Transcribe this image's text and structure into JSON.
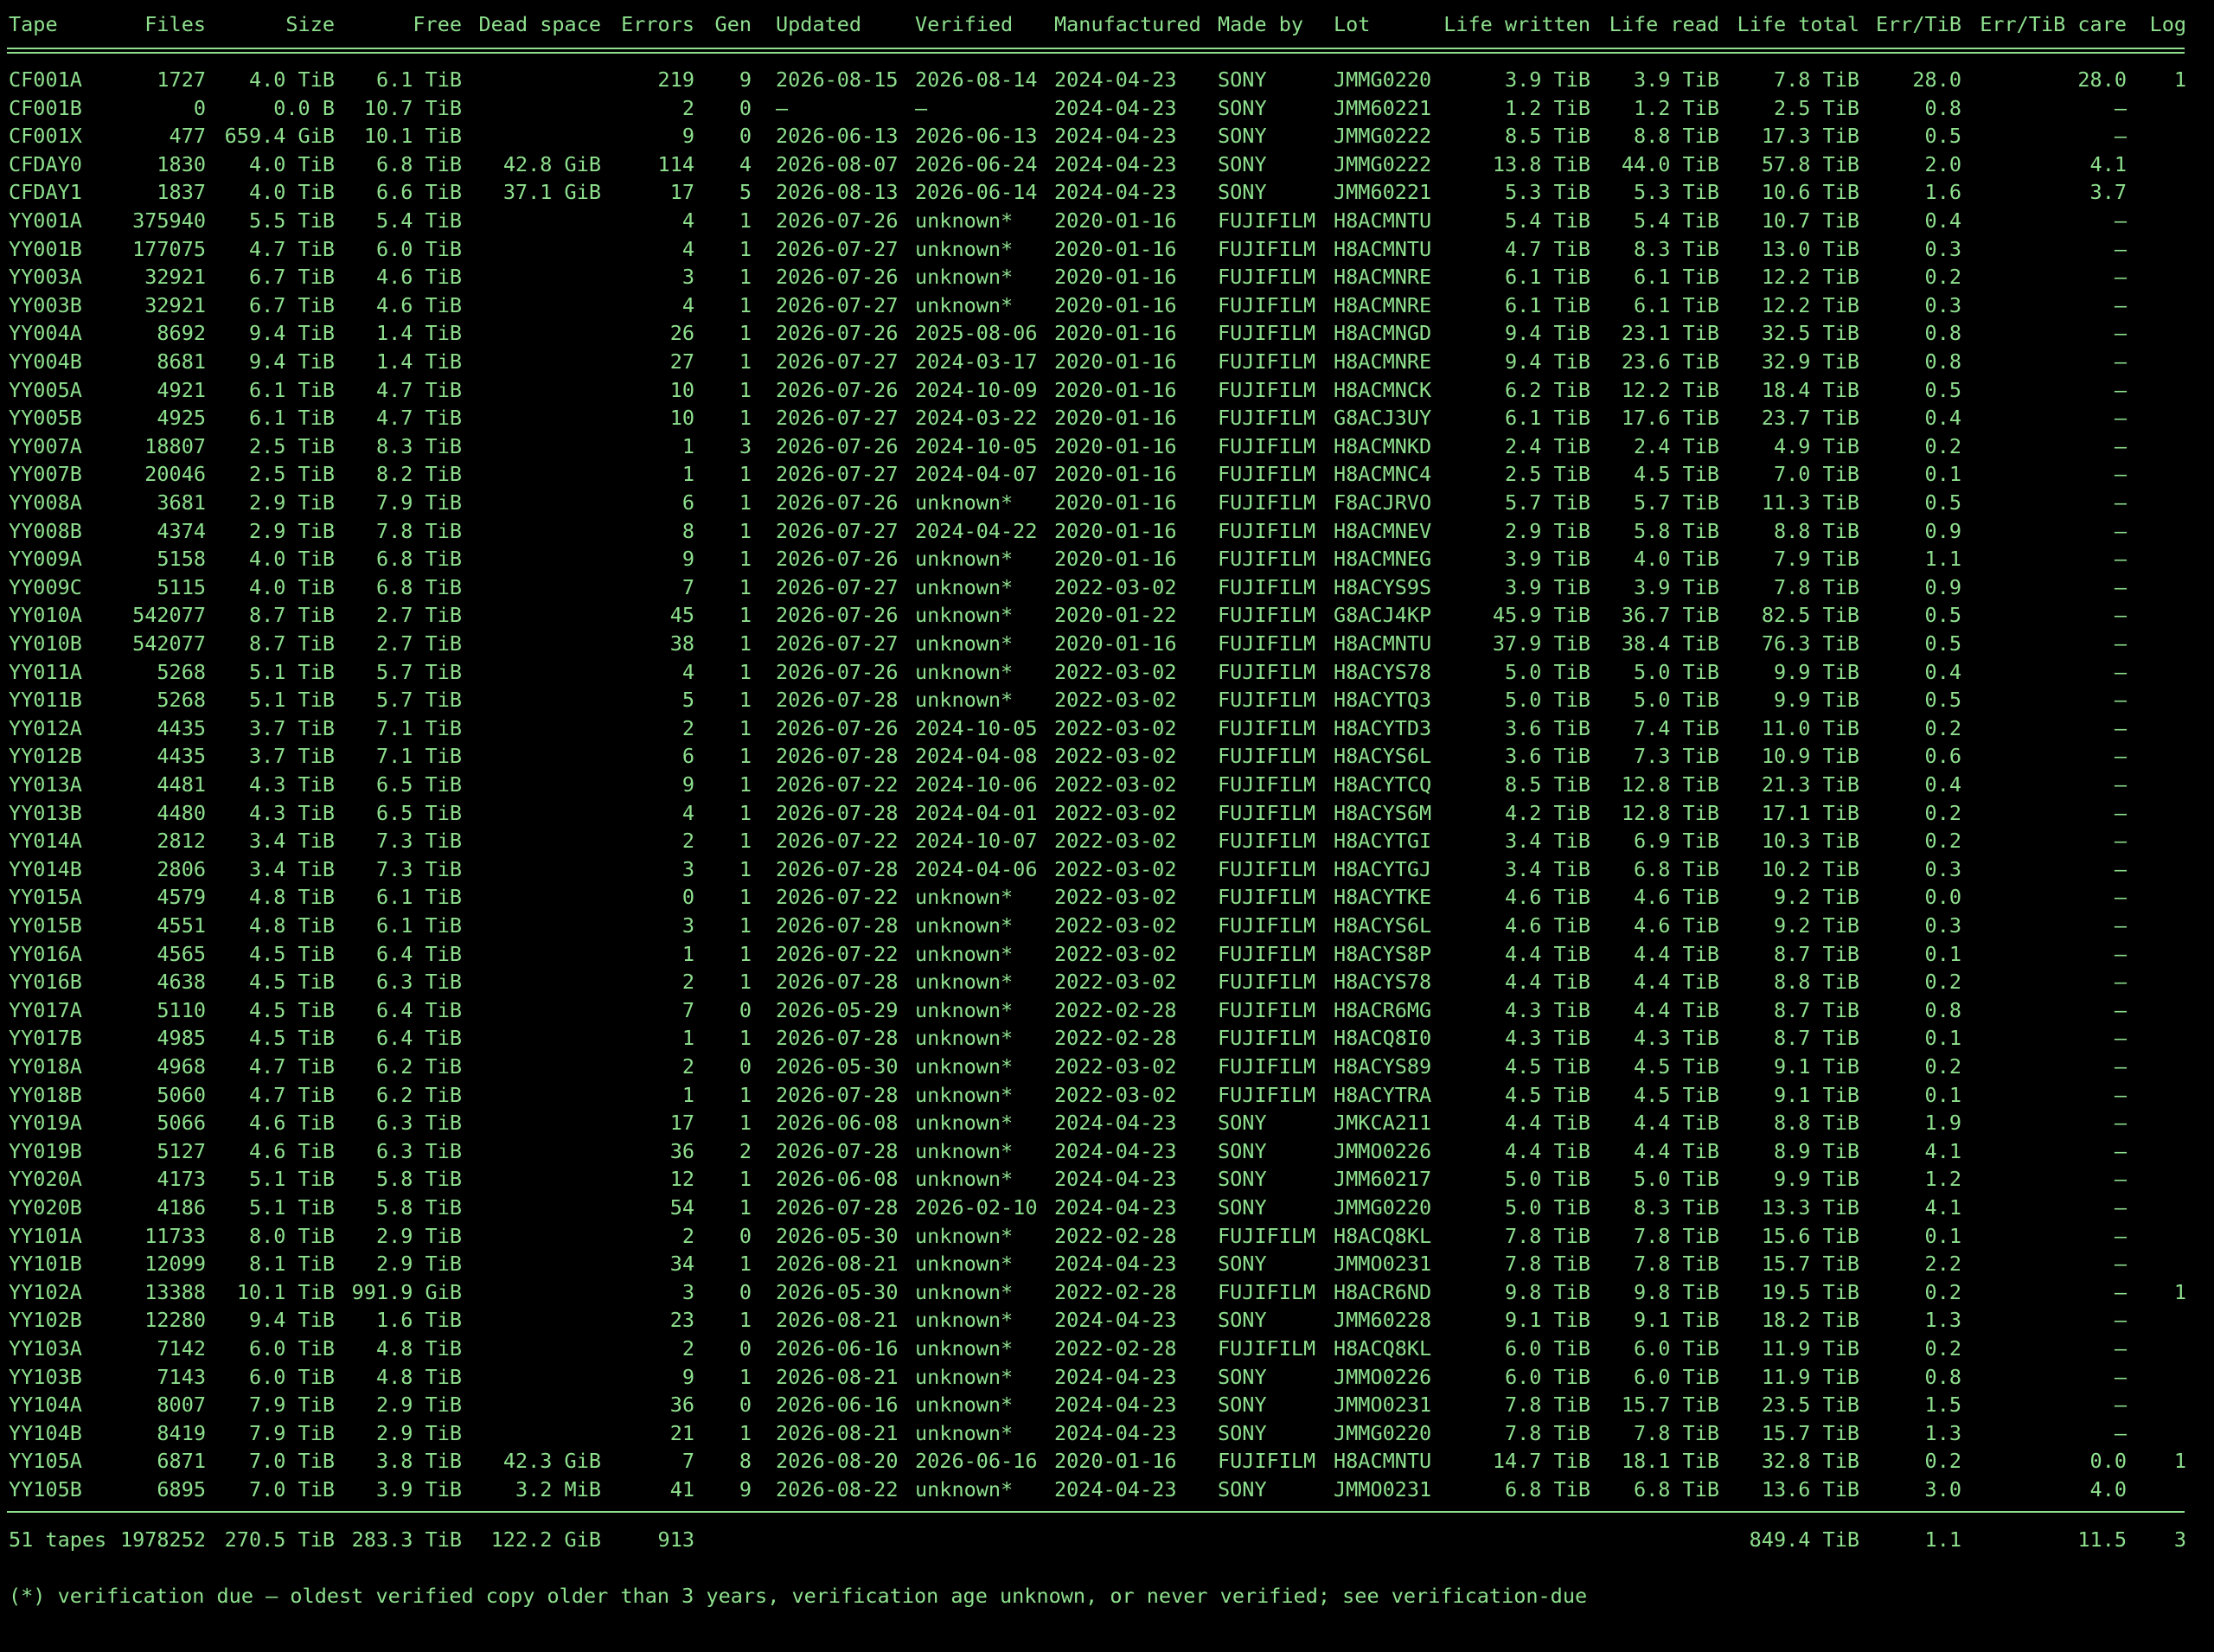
{
  "columns": [
    {
      "key": "tape",
      "label": "Tape"
    },
    {
      "key": "files",
      "label": "Files"
    },
    {
      "key": "size",
      "label": "Size"
    },
    {
      "key": "free",
      "label": "Free"
    },
    {
      "key": "dead",
      "label": "Dead space"
    },
    {
      "key": "errors",
      "label": "Errors"
    },
    {
      "key": "gen",
      "label": "Gen"
    },
    {
      "key": "updated",
      "label": "Updated"
    },
    {
      "key": "verified",
      "label": "Verified"
    },
    {
      "key": "manufactured",
      "label": "Manufactured"
    },
    {
      "key": "madeby",
      "label": "Made by"
    },
    {
      "key": "lot",
      "label": "Lot"
    },
    {
      "key": "lifewritten",
      "label": "Life written"
    },
    {
      "key": "liferead",
      "label": "Life read"
    },
    {
      "key": "lifetotal",
      "label": "Life total"
    },
    {
      "key": "errtib",
      "label": "Err/TiB"
    },
    {
      "key": "errtibcare",
      "label": "Err/TiB care"
    },
    {
      "key": "log",
      "label": "Log"
    }
  ],
  "rows": [
    [
      "CF001A",
      "1727",
      "4.0 TiB",
      "6.1 TiB",
      "",
      "219",
      "9",
      "2026-08-15",
      "2026-08-14",
      "2024-04-23",
      "SONY",
      "JMMG0220",
      "3.9 TiB",
      "3.9 TiB",
      "7.8 TiB",
      "28.0",
      "28.0",
      "1"
    ],
    [
      "CF001B",
      "0",
      "0.0 B",
      "10.7 TiB",
      "",
      "2",
      "0",
      "–",
      "–",
      "2024-04-23",
      "SONY",
      "JMM60221",
      "1.2 TiB",
      "1.2 TiB",
      "2.5 TiB",
      "0.8",
      "–",
      ""
    ],
    [
      "CF001X",
      "477",
      "659.4 GiB",
      "10.1 TiB",
      "",
      "9",
      "0",
      "2026-06-13",
      "2026-06-13",
      "2024-04-23",
      "SONY",
      "JMMG0222",
      "8.5 TiB",
      "8.8 TiB",
      "17.3 TiB",
      "0.5",
      "–",
      ""
    ],
    [
      "CFDAY0",
      "1830",
      "4.0 TiB",
      "6.8 TiB",
      "42.8 GiB",
      "114",
      "4",
      "2026-08-07",
      "2026-06-24",
      "2024-04-23",
      "SONY",
      "JMMG0222",
      "13.8 TiB",
      "44.0 TiB",
      "57.8 TiB",
      "2.0",
      "4.1",
      ""
    ],
    [
      "CFDAY1",
      "1837",
      "4.0 TiB",
      "6.6 TiB",
      "37.1 GiB",
      "17",
      "5",
      "2026-08-13",
      "2026-06-14",
      "2024-04-23",
      "SONY",
      "JMM60221",
      "5.3 TiB",
      "5.3 TiB",
      "10.6 TiB",
      "1.6",
      "3.7",
      ""
    ],
    [
      "YY001A",
      "375940",
      "5.5 TiB",
      "5.4 TiB",
      "",
      "4",
      "1",
      "2026-07-26",
      "unknown*",
      "2020-01-16",
      "FUJIFILM",
      "H8ACMNTU",
      "5.4 TiB",
      "5.4 TiB",
      "10.7 TiB",
      "0.4",
      "–",
      ""
    ],
    [
      "YY001B",
      "177075",
      "4.7 TiB",
      "6.0 TiB",
      "",
      "4",
      "1",
      "2026-07-27",
      "unknown*",
      "2020-01-16",
      "FUJIFILM",
      "H8ACMNTU",
      "4.7 TiB",
      "8.3 TiB",
      "13.0 TiB",
      "0.3",
      "–",
      ""
    ],
    [
      "YY003A",
      "32921",
      "6.7 TiB",
      "4.6 TiB",
      "",
      "3",
      "1",
      "2026-07-26",
      "unknown*",
      "2020-01-16",
      "FUJIFILM",
      "H8ACMNRE",
      "6.1 TiB",
      "6.1 TiB",
      "12.2 TiB",
      "0.2",
      "–",
      ""
    ],
    [
      "YY003B",
      "32921",
      "6.7 TiB",
      "4.6 TiB",
      "",
      "4",
      "1",
      "2026-07-27",
      "unknown*",
      "2020-01-16",
      "FUJIFILM",
      "H8ACMNRE",
      "6.1 TiB",
      "6.1 TiB",
      "12.2 TiB",
      "0.3",
      "–",
      ""
    ],
    [
      "YY004A",
      "8692",
      "9.4 TiB",
      "1.4 TiB",
      "",
      "26",
      "1",
      "2026-07-26",
      "2025-08-06",
      "2020-01-16",
      "FUJIFILM",
      "H8ACMNGD",
      "9.4 TiB",
      "23.1 TiB",
      "32.5 TiB",
      "0.8",
      "–",
      ""
    ],
    [
      "YY004B",
      "8681",
      "9.4 TiB",
      "1.4 TiB",
      "",
      "27",
      "1",
      "2026-07-27",
      "2024-03-17",
      "2020-01-16",
      "FUJIFILM",
      "H8ACMNRE",
      "9.4 TiB",
      "23.6 TiB",
      "32.9 TiB",
      "0.8",
      "–",
      ""
    ],
    [
      "YY005A",
      "4921",
      "6.1 TiB",
      "4.7 TiB",
      "",
      "10",
      "1",
      "2026-07-26",
      "2024-10-09",
      "2020-01-16",
      "FUJIFILM",
      "H8ACMNCK",
      "6.2 TiB",
      "12.2 TiB",
      "18.4 TiB",
      "0.5",
      "–",
      ""
    ],
    [
      "YY005B",
      "4925",
      "6.1 TiB",
      "4.7 TiB",
      "",
      "10",
      "1",
      "2026-07-27",
      "2024-03-22",
      "2020-01-16",
      "FUJIFILM",
      "G8ACJ3UY",
      "6.1 TiB",
      "17.6 TiB",
      "23.7 TiB",
      "0.4",
      "–",
      ""
    ],
    [
      "YY007A",
      "18807",
      "2.5 TiB",
      "8.3 TiB",
      "",
      "1",
      "3",
      "2026-07-26",
      "2024-10-05",
      "2020-01-16",
      "FUJIFILM",
      "H8ACMNKD",
      "2.4 TiB",
      "2.4 TiB",
      "4.9 TiB",
      "0.2",
      "–",
      ""
    ],
    [
      "YY007B",
      "20046",
      "2.5 TiB",
      "8.2 TiB",
      "",
      "1",
      "1",
      "2026-07-27",
      "2024-04-07",
      "2020-01-16",
      "FUJIFILM",
      "H8ACMNC4",
      "2.5 TiB",
      "4.5 TiB",
      "7.0 TiB",
      "0.1",
      "–",
      ""
    ],
    [
      "YY008A",
      "3681",
      "2.9 TiB",
      "7.9 TiB",
      "",
      "6",
      "1",
      "2026-07-26",
      "unknown*",
      "2020-01-16",
      "FUJIFILM",
      "F8ACJRVO",
      "5.7 TiB",
      "5.7 TiB",
      "11.3 TiB",
      "0.5",
      "–",
      ""
    ],
    [
      "YY008B",
      "4374",
      "2.9 TiB",
      "7.8 TiB",
      "",
      "8",
      "1",
      "2026-07-27",
      "2024-04-22",
      "2020-01-16",
      "FUJIFILM",
      "H8ACMNEV",
      "2.9 TiB",
      "5.8 TiB",
      "8.8 TiB",
      "0.9",
      "–",
      ""
    ],
    [
      "YY009A",
      "5158",
      "4.0 TiB",
      "6.8 TiB",
      "",
      "9",
      "1",
      "2026-07-26",
      "unknown*",
      "2020-01-16",
      "FUJIFILM",
      "H8ACMNEG",
      "3.9 TiB",
      "4.0 TiB",
      "7.9 TiB",
      "1.1",
      "–",
      ""
    ],
    [
      "YY009C",
      "5115",
      "4.0 TiB",
      "6.8 TiB",
      "",
      "7",
      "1",
      "2026-07-27",
      "unknown*",
      "2022-03-02",
      "FUJIFILM",
      "H8ACYS9S",
      "3.9 TiB",
      "3.9 TiB",
      "7.8 TiB",
      "0.9",
      "–",
      ""
    ],
    [
      "YY010A",
      "542077",
      "8.7 TiB",
      "2.7 TiB",
      "",
      "45",
      "1",
      "2026-07-26",
      "unknown*",
      "2020-01-22",
      "FUJIFILM",
      "G8ACJ4KP",
      "45.9 TiB",
      "36.7 TiB",
      "82.5 TiB",
      "0.5",
      "–",
      ""
    ],
    [
      "YY010B",
      "542077",
      "8.7 TiB",
      "2.7 TiB",
      "",
      "38",
      "1",
      "2026-07-27",
      "unknown*",
      "2020-01-16",
      "FUJIFILM",
      "H8ACMNTU",
      "37.9 TiB",
      "38.4 TiB",
      "76.3 TiB",
      "0.5",
      "–",
      ""
    ],
    [
      "YY011A",
      "5268",
      "5.1 TiB",
      "5.7 TiB",
      "",
      "4",
      "1",
      "2026-07-26",
      "unknown*",
      "2022-03-02",
      "FUJIFILM",
      "H8ACYS78",
      "5.0 TiB",
      "5.0 TiB",
      "9.9 TiB",
      "0.4",
      "–",
      ""
    ],
    [
      "YY011B",
      "5268",
      "5.1 TiB",
      "5.7 TiB",
      "",
      "5",
      "1",
      "2026-07-28",
      "unknown*",
      "2022-03-02",
      "FUJIFILM",
      "H8ACYTQ3",
      "5.0 TiB",
      "5.0 TiB",
      "9.9 TiB",
      "0.5",
      "–",
      ""
    ],
    [
      "YY012A",
      "4435",
      "3.7 TiB",
      "7.1 TiB",
      "",
      "2",
      "1",
      "2026-07-26",
      "2024-10-05",
      "2022-03-02",
      "FUJIFILM",
      "H8ACYTD3",
      "3.6 TiB",
      "7.4 TiB",
      "11.0 TiB",
      "0.2",
      "–",
      ""
    ],
    [
      "YY012B",
      "4435",
      "3.7 TiB",
      "7.1 TiB",
      "",
      "6",
      "1",
      "2026-07-28",
      "2024-04-08",
      "2022-03-02",
      "FUJIFILM",
      "H8ACYS6L",
      "3.6 TiB",
      "7.3 TiB",
      "10.9 TiB",
      "0.6",
      "–",
      ""
    ],
    [
      "YY013A",
      "4481",
      "4.3 TiB",
      "6.5 TiB",
      "",
      "9",
      "1",
      "2026-07-22",
      "2024-10-06",
      "2022-03-02",
      "FUJIFILM",
      "H8ACYTCQ",
      "8.5 TiB",
      "12.8 TiB",
      "21.3 TiB",
      "0.4",
      "–",
      ""
    ],
    [
      "YY013B",
      "4480",
      "4.3 TiB",
      "6.5 TiB",
      "",
      "4",
      "1",
      "2026-07-28",
      "2024-04-01",
      "2022-03-02",
      "FUJIFILM",
      "H8ACYS6M",
      "4.2 TiB",
      "12.8 TiB",
      "17.1 TiB",
      "0.2",
      "–",
      ""
    ],
    [
      "YY014A",
      "2812",
      "3.4 TiB",
      "7.3 TiB",
      "",
      "2",
      "1",
      "2026-07-22",
      "2024-10-07",
      "2022-03-02",
      "FUJIFILM",
      "H8ACYTGI",
      "3.4 TiB",
      "6.9 TiB",
      "10.3 TiB",
      "0.2",
      "–",
      ""
    ],
    [
      "YY014B",
      "2806",
      "3.4 TiB",
      "7.3 TiB",
      "",
      "3",
      "1",
      "2026-07-28",
      "2024-04-06",
      "2022-03-02",
      "FUJIFILM",
      "H8ACYTGJ",
      "3.4 TiB",
      "6.8 TiB",
      "10.2 TiB",
      "0.3",
      "–",
      ""
    ],
    [
      "YY015A",
      "4579",
      "4.8 TiB",
      "6.1 TiB",
      "",
      "0",
      "1",
      "2026-07-22",
      "unknown*",
      "2022-03-02",
      "FUJIFILM",
      "H8ACYTKE",
      "4.6 TiB",
      "4.6 TiB",
      "9.2 TiB",
      "0.0",
      "–",
      ""
    ],
    [
      "YY015B",
      "4551",
      "4.8 TiB",
      "6.1 TiB",
      "",
      "3",
      "1",
      "2026-07-28",
      "unknown*",
      "2022-03-02",
      "FUJIFILM",
      "H8ACYS6L",
      "4.6 TiB",
      "4.6 TiB",
      "9.2 TiB",
      "0.3",
      "–",
      ""
    ],
    [
      "YY016A",
      "4565",
      "4.5 TiB",
      "6.4 TiB",
      "",
      "1",
      "1",
      "2026-07-22",
      "unknown*",
      "2022-03-02",
      "FUJIFILM",
      "H8ACYS8P",
      "4.4 TiB",
      "4.4 TiB",
      "8.7 TiB",
      "0.1",
      "–",
      ""
    ],
    [
      "YY016B",
      "4638",
      "4.5 TiB",
      "6.3 TiB",
      "",
      "2",
      "1",
      "2026-07-28",
      "unknown*",
      "2022-03-02",
      "FUJIFILM",
      "H8ACYS78",
      "4.4 TiB",
      "4.4 TiB",
      "8.8 TiB",
      "0.2",
      "–",
      ""
    ],
    [
      "YY017A",
      "5110",
      "4.5 TiB",
      "6.4 TiB",
      "",
      "7",
      "0",
      "2026-05-29",
      "unknown*",
      "2022-02-28",
      "FUJIFILM",
      "H8ACR6MG",
      "4.3 TiB",
      "4.4 TiB",
      "8.7 TiB",
      "0.8",
      "–",
      ""
    ],
    [
      "YY017B",
      "4985",
      "4.5 TiB",
      "6.4 TiB",
      "",
      "1",
      "1",
      "2026-07-28",
      "unknown*",
      "2022-02-28",
      "FUJIFILM",
      "H8ACQ8I0",
      "4.3 TiB",
      "4.3 TiB",
      "8.7 TiB",
      "0.1",
      "–",
      ""
    ],
    [
      "YY018A",
      "4968",
      "4.7 TiB",
      "6.2 TiB",
      "",
      "2",
      "0",
      "2026-05-30",
      "unknown*",
      "2022-03-02",
      "FUJIFILM",
      "H8ACYS89",
      "4.5 TiB",
      "4.5 TiB",
      "9.1 TiB",
      "0.2",
      "–",
      ""
    ],
    [
      "YY018B",
      "5060",
      "4.7 TiB",
      "6.2 TiB",
      "",
      "1",
      "1",
      "2026-07-28",
      "unknown*",
      "2022-03-02",
      "FUJIFILM",
      "H8ACYTRA",
      "4.5 TiB",
      "4.5 TiB",
      "9.1 TiB",
      "0.1",
      "–",
      ""
    ],
    [
      "YY019A",
      "5066",
      "4.6 TiB",
      "6.3 TiB",
      "",
      "17",
      "1",
      "2026-06-08",
      "unknown*",
      "2024-04-23",
      "SONY",
      "JMKCA211",
      "4.4 TiB",
      "4.4 TiB",
      "8.8 TiB",
      "1.9",
      "–",
      ""
    ],
    [
      "YY019B",
      "5127",
      "4.6 TiB",
      "6.3 TiB",
      "",
      "36",
      "2",
      "2026-07-28",
      "unknown*",
      "2024-04-23",
      "SONY",
      "JMMO0226",
      "4.4 TiB",
      "4.4 TiB",
      "8.9 TiB",
      "4.1",
      "–",
      ""
    ],
    [
      "YY020A",
      "4173",
      "5.1 TiB",
      "5.8 TiB",
      "",
      "12",
      "1",
      "2026-06-08",
      "unknown*",
      "2024-04-23",
      "SONY",
      "JMM60217",
      "5.0 TiB",
      "5.0 TiB",
      "9.9 TiB",
      "1.2",
      "–",
      ""
    ],
    [
      "YY020B",
      "4186",
      "5.1 TiB",
      "5.8 TiB",
      "",
      "54",
      "1",
      "2026-07-28",
      "2026-02-10",
      "2024-04-23",
      "SONY",
      "JMMG0220",
      "5.0 TiB",
      "8.3 TiB",
      "13.3 TiB",
      "4.1",
      "–",
      ""
    ],
    [
      "YY101A",
      "11733",
      "8.0 TiB",
      "2.9 TiB",
      "",
      "2",
      "0",
      "2026-05-30",
      "unknown*",
      "2022-02-28",
      "FUJIFILM",
      "H8ACQ8KL",
      "7.8 TiB",
      "7.8 TiB",
      "15.6 TiB",
      "0.1",
      "–",
      ""
    ],
    [
      "YY101B",
      "12099",
      "8.1 TiB",
      "2.9 TiB",
      "",
      "34",
      "1",
      "2026-08-21",
      "unknown*",
      "2024-04-23",
      "SONY",
      "JMMO0231",
      "7.8 TiB",
      "7.8 TiB",
      "15.7 TiB",
      "2.2",
      "–",
      ""
    ],
    [
      "YY102A",
      "13388",
      "10.1 TiB",
      "991.9 GiB",
      "",
      "3",
      "0",
      "2026-05-30",
      "unknown*",
      "2022-02-28",
      "FUJIFILM",
      "H8ACR6ND",
      "9.8 TiB",
      "9.8 TiB",
      "19.5 TiB",
      "0.2",
      "–",
      "1"
    ],
    [
      "YY102B",
      "12280",
      "9.4 TiB",
      "1.6 TiB",
      "",
      "23",
      "1",
      "2026-08-21",
      "unknown*",
      "2024-04-23",
      "SONY",
      "JMM60228",
      "9.1 TiB",
      "9.1 TiB",
      "18.2 TiB",
      "1.3",
      "–",
      ""
    ],
    [
      "YY103A",
      "7142",
      "6.0 TiB",
      "4.8 TiB",
      "",
      "2",
      "0",
      "2026-06-16",
      "unknown*",
      "2022-02-28",
      "FUJIFILM",
      "H8ACQ8KL",
      "6.0 TiB",
      "6.0 TiB",
      "11.9 TiB",
      "0.2",
      "–",
      ""
    ],
    [
      "YY103B",
      "7143",
      "6.0 TiB",
      "4.8 TiB",
      "",
      "9",
      "1",
      "2026-08-21",
      "unknown*",
      "2024-04-23",
      "SONY",
      "JMMO0226",
      "6.0 TiB",
      "6.0 TiB",
      "11.9 TiB",
      "0.8",
      "–",
      ""
    ],
    [
      "YY104A",
      "8007",
      "7.9 TiB",
      "2.9 TiB",
      "",
      "36",
      "0",
      "2026-06-16",
      "unknown*",
      "2024-04-23",
      "SONY",
      "JMMO0231",
      "7.8 TiB",
      "15.7 TiB",
      "23.5 TiB",
      "1.5",
      "–",
      ""
    ],
    [
      "YY104B",
      "8419",
      "7.9 TiB",
      "2.9 TiB",
      "",
      "21",
      "1",
      "2026-08-21",
      "unknown*",
      "2024-04-23",
      "SONY",
      "JMMG0220",
      "7.8 TiB",
      "7.8 TiB",
      "15.7 TiB",
      "1.3",
      "–",
      ""
    ],
    [
      "YY105A",
      "6871",
      "7.0 TiB",
      "3.8 TiB",
      "42.3 GiB",
      "7",
      "8",
      "2026-08-20",
      "2026-06-16",
      "2020-01-16",
      "FUJIFILM",
      "H8ACMNTU",
      "14.7 TiB",
      "18.1 TiB",
      "32.8 TiB",
      "0.2",
      "0.0",
      "1"
    ],
    [
      "YY105B",
      "6895",
      "7.0 TiB",
      "3.9 TiB",
      "3.2 MiB",
      "41",
      "9",
      "2026-08-22",
      "unknown*",
      "2024-04-23",
      "SONY",
      "JMMO0231",
      "6.8 TiB",
      "6.8 TiB",
      "13.6 TiB",
      "3.0",
      "4.0",
      ""
    ]
  ],
  "totals": {
    "tape": "51 tapes",
    "files": "1978252",
    "size": "270.5 TiB",
    "free": "283.3 TiB",
    "dead": "122.2 GiB",
    "errors": "913",
    "lifetotal": "849.4 TiB",
    "errtib": "1.1",
    "errtibcare": "11.5",
    "log": "3"
  },
  "footnote": "(*) verification due – oldest verified copy older than 3 years, verification age unknown, or never verified; see verification-due",
  "colors": {
    "background": "#000000",
    "foreground": "#8ee08e"
  }
}
